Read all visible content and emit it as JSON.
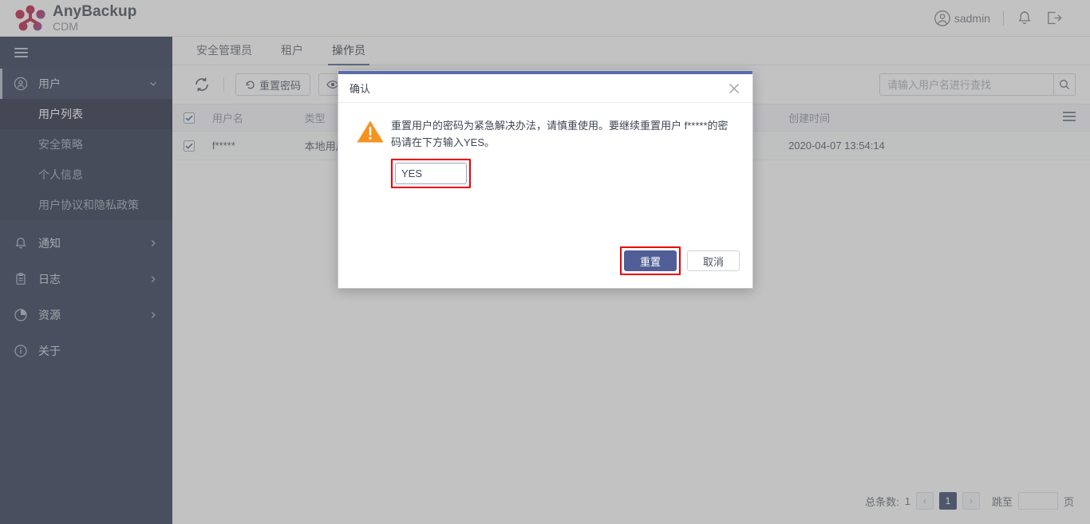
{
  "header": {
    "logo_title": "AnyBackup",
    "logo_subtitle": "CDM",
    "user_name": "sadmin",
    "icons": {
      "account": "account-circle-icon",
      "bell": "notification-bell-icon",
      "logout": "logout-icon"
    }
  },
  "sidebar": {
    "menu_toggle": "hamburger-menu-icon",
    "groups": [
      {
        "label": "用户",
        "icon": "user-circle-icon",
        "expanded": true,
        "items": [
          {
            "label": "用户列表",
            "active": true
          },
          {
            "label": "安全策略",
            "active": false
          },
          {
            "label": "个人信息",
            "active": false
          },
          {
            "label": "用户协议和隐私政策",
            "active": false
          }
        ]
      },
      {
        "label": "通知",
        "icon": "bell-icon",
        "expanded": false,
        "items": []
      },
      {
        "label": "日志",
        "icon": "clipboard-icon",
        "expanded": false,
        "items": []
      },
      {
        "label": "资源",
        "icon": "pie-chart-icon",
        "expanded": false,
        "items": []
      },
      {
        "label": "关于",
        "icon": "info-icon",
        "expanded": false,
        "items": []
      }
    ]
  },
  "tabs": [
    {
      "label": "安全管理员",
      "active": false
    },
    {
      "label": "租户",
      "active": false
    },
    {
      "label": "操作员",
      "active": true
    }
  ],
  "toolbar": {
    "refresh_icon": "refresh-icon",
    "reset_password_label": "重置密码",
    "reset_password_icon": "undo-arrow-icon",
    "view_icon": "eye-icon",
    "search_placeholder": "请输入用户名进行查找",
    "search_value": "",
    "search_icon": "search-icon"
  },
  "table": {
    "columns": [
      "用户名",
      "类型",
      "",
      "",
      "创建时间"
    ],
    "header_select_all": true,
    "column_menu_icon": "column-settings-icon",
    "rows": [
      {
        "selected": true,
        "username": "f*****",
        "type": "本地用户",
        "created": "2020-04-07 13:54:14"
      }
    ]
  },
  "pagination": {
    "total_label": "总条数:",
    "total_value": "1",
    "prev_label": "‹",
    "next_label": "›",
    "current_page": "1",
    "jump_label": "跳至",
    "jump_value": "",
    "page_unit": "页"
  },
  "dialog": {
    "title": "确认",
    "close_icon": "close-icon",
    "warning_icon": "warning-triangle-icon",
    "message": "重置用户的密码为紧急解决办法，请慎重使用。要继续重置用户 f*****的密码请在下方输入YES。",
    "confirm_input_value": "YES",
    "confirm_button": "重置",
    "cancel_button": "取消",
    "accent_color": "#5a6ba8",
    "highlight_color": "#ee0000",
    "warning_color": "#f7921e"
  }
}
